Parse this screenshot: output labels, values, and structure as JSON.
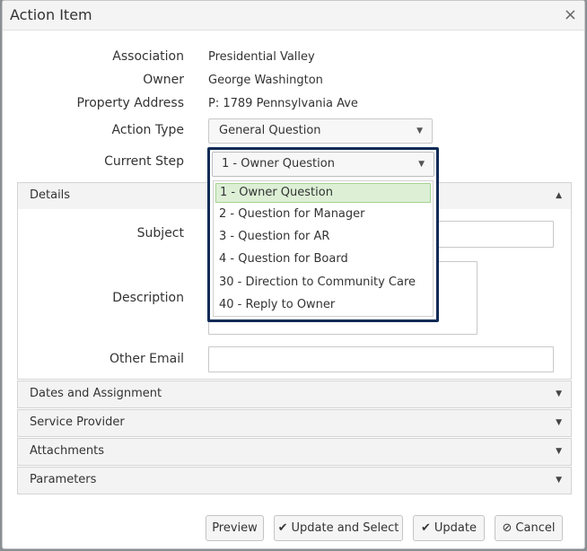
{
  "dialog": {
    "title": "Action Item",
    "close_glyph": "×"
  },
  "fields": {
    "association": {
      "label": "Association",
      "value": "Presidential Valley"
    },
    "owner": {
      "label": "Owner",
      "value": "George Washington"
    },
    "property_address": {
      "label": "Property Address",
      "value": "P: 1789 Pennsylvania Ave"
    },
    "action_type": {
      "label": "Action Type",
      "value": "General Question"
    },
    "current_step": {
      "label": "Current Step",
      "value": "1 - Owner Question"
    }
  },
  "current_step_options": [
    "1 - Owner Question",
    "2 - Question for Manager",
    "3 - Question for AR",
    "4 - Question for Board",
    "30 - Direction to Community Care",
    "40 - Reply to Owner"
  ],
  "sections": {
    "details": "Details",
    "dates": "Dates and Assignment",
    "provider": "Service Provider",
    "attachments": "Attachments",
    "parameters": "Parameters"
  },
  "details": {
    "subject_label": "Subject",
    "description_label": "Description",
    "other_email_label": "Other Email"
  },
  "buttons": {
    "preview": "Preview",
    "update_select": "Update and Select",
    "update": "Update",
    "cancel": "Cancel"
  },
  "icons": {
    "caret_down": "▼",
    "caret_up": "▲",
    "check": "✔",
    "cancel": "⊘"
  },
  "colors": {
    "dropdown_border": "#0d2a55",
    "selected_option_bg": "#ddf0d6"
  }
}
